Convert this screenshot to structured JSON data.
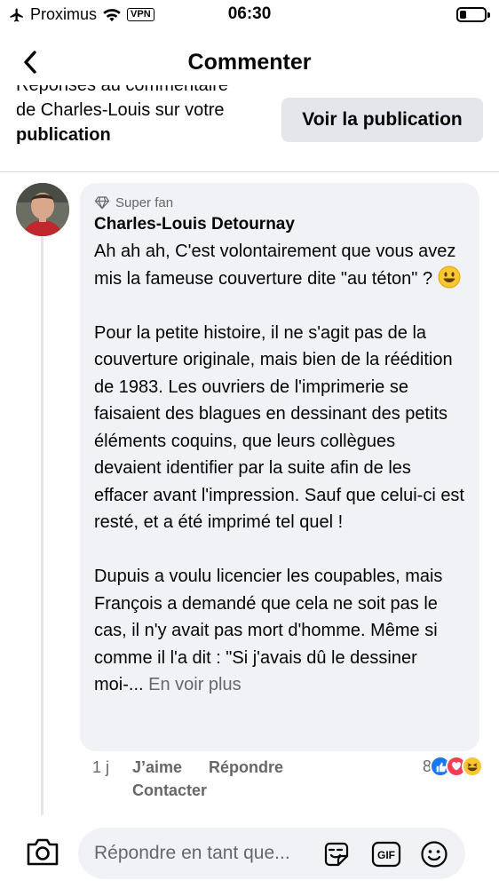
{
  "status_bar": {
    "carrier": "Proximus",
    "vpn": "VPN",
    "time": "06:30"
  },
  "header": {
    "title": "Commenter"
  },
  "context": {
    "line1": "Réponses au commentaire",
    "line2": "de Charles-Louis sur votre",
    "line3": "publication",
    "view_post_label": "Voir la publication"
  },
  "comment": {
    "badge": "Super fan",
    "author": "Charles-Louis Detournay",
    "paragraph1": "Ah ah ah, C'est volontairement que vous avez mis la fameuse couverture dite \"au téton\" ?",
    "paragraph2": "Pour la petite histoire, il ne s'agit pas de la couverture originale, mais bien de la réédition de 1983. Les ouvriers de l'imprimerie se faisaient des blagues en dessinant des petits éléments coquins, que leurs collègues devaient identifier par la suite afin de les effacer avant l'impression. Sauf que celui-ci est resté, et a été imprimé tel quel !",
    "paragraph3": "Dupuis a voulu licencier les coupables, mais François a demandé que cela ne soit pas le cas, il n'y avait pas mort d'homme. Même si comme il l'a dit : \"Si j'avais dû le dessiner moi-...",
    "see_more": "En voir plus",
    "time": "1 j",
    "like_label": "J’aime",
    "reply_label": "Répondre",
    "contact_label": "Contacter",
    "reaction_count": "8"
  },
  "composer": {
    "placeholder": "Répondre en tant que..."
  },
  "colors": {
    "bubble_bg": "#f0f2f5",
    "button_bg": "#e4e6eb",
    "secondary_text": "#65676b",
    "like_blue": "#1877f2",
    "love_red": "#f33e58"
  }
}
